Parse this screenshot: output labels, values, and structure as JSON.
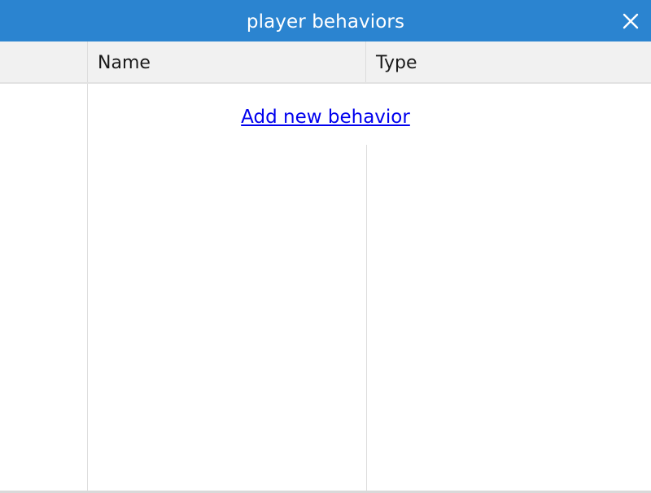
{
  "window": {
    "title": "player behaviors",
    "close_icon": "close-icon"
  },
  "table": {
    "columns": [
      "",
      "Name",
      "Type"
    ],
    "rows": []
  },
  "actions": {
    "add_behavior_label": "Add new behavior"
  },
  "colors": {
    "titlebar": "#2b84d0",
    "header_bg": "#f1f1f1",
    "link": "#0000ee"
  }
}
